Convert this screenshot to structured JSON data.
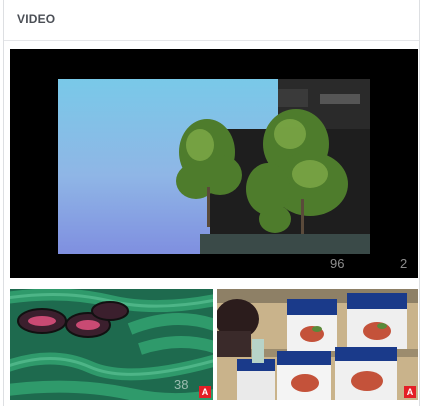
{
  "section": {
    "title": "VIDEO"
  },
  "videos": [
    {
      "overlay_left": "96",
      "overlay_right": "2"
    },
    {
      "overlay_left": "38",
      "badge": "A"
    },
    {
      "badge": "A"
    }
  ],
  "colors": {
    "badge": "#e41e26",
    "header_text": "#4b4f56",
    "border": "#dddfe2"
  }
}
